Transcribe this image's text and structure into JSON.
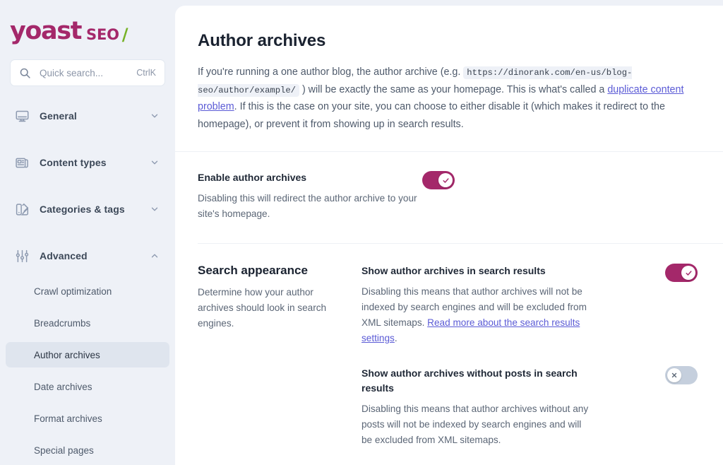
{
  "brand": {
    "name": "yoast",
    "product": "SEO",
    "slash": "/",
    "primary_color": "#a4286a",
    "accent_color": "#77b227"
  },
  "search": {
    "icon": "search-icon",
    "placeholder": "Quick search...",
    "shortcut": "CtrlK"
  },
  "sidebar": {
    "groups": [
      {
        "label": "General",
        "icon": "monitor-icon",
        "expanded": false,
        "chevron": "chevron-down-icon"
      },
      {
        "label": "Content types",
        "icon": "article-icon",
        "expanded": false,
        "chevron": "chevron-down-icon"
      },
      {
        "label": "Categories & tags",
        "icon": "swatch-icon",
        "expanded": false,
        "chevron": "chevron-down-icon"
      },
      {
        "label": "Advanced",
        "icon": "sliders-icon",
        "expanded": true,
        "chevron": "chevron-up-icon"
      }
    ],
    "advanced_items": [
      {
        "label": "Crawl optimization",
        "active": false
      },
      {
        "label": "Breadcrumbs",
        "active": false
      },
      {
        "label": "Author archives",
        "active": true
      },
      {
        "label": "Date archives",
        "active": false
      },
      {
        "label": "Format archives",
        "active": false
      },
      {
        "label": "Special pages",
        "active": false
      }
    ]
  },
  "page": {
    "title": "Author archives",
    "intro_part1": "If you're running a one author blog, the author archive (e.g. ",
    "intro_url": "https://dinorank.com/en-us/blog-seo/author/example/",
    "intro_part2": " ) will be exactly the same as your homepage. This is what's called a ",
    "intro_link": "duplicate content problem",
    "intro_part3": ". If this is the case on your site, you can choose to either disable it (which makes it redirect to the homepage), or prevent it from showing up in search results."
  },
  "enable_section": {
    "label": "Enable author archives",
    "description": "Disabling this will redirect the author archive to your site's homepage.",
    "toggle": {
      "state": "on",
      "icon": "check-icon"
    }
  },
  "search_appearance": {
    "title": "Search appearance",
    "description": "Determine how your author archives should look in search engines.",
    "fields": [
      {
        "label": "Show author archives in search results",
        "desc_part1": "Disabling this means that author archives will not be indexed by search engines and will be excluded from XML sitemaps. ",
        "link": "Read more about the search results settings",
        "desc_part2": ".",
        "toggle": {
          "state": "on",
          "icon": "check-icon"
        }
      },
      {
        "label": "Show author archives without posts in search results",
        "desc_part1": "Disabling this means that author archives without any posts will not be indexed by search engines and will be excluded from XML sitemaps.",
        "link": "",
        "desc_part2": "",
        "toggle": {
          "state": "off",
          "icon": "cross-icon"
        }
      }
    ]
  }
}
